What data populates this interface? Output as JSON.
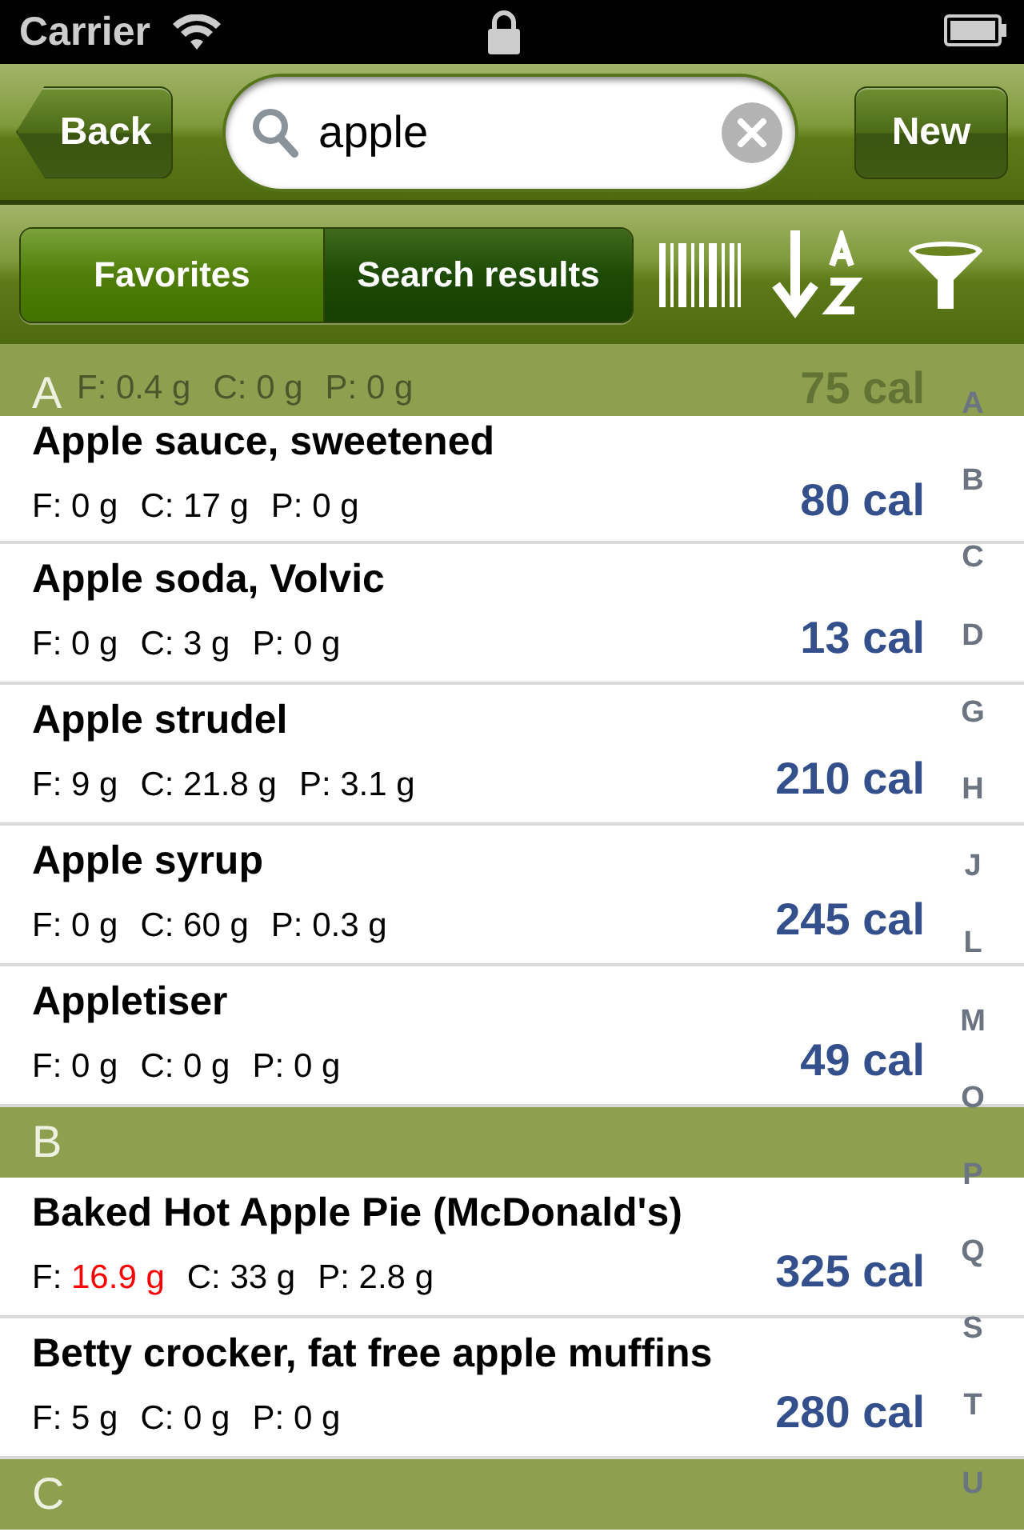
{
  "status_bar": {
    "carrier": "Carrier"
  },
  "nav": {
    "back": "Back",
    "search": {
      "value": "apple"
    },
    "new": "New"
  },
  "segments": [
    {
      "label": "Favorites",
      "selected": false
    },
    {
      "label": "Search results",
      "selected": true
    }
  ],
  "partial_row": {
    "nutrients": [
      {
        "label": "F:",
        "value": "0.4 g",
        "high": false
      },
      {
        "label": "C:",
        "value": "0 g",
        "high": false
      },
      {
        "label": "P:",
        "value": "0 g",
        "high": false
      }
    ],
    "calories": "75 cal"
  },
  "sections": [
    {
      "letter": "A",
      "rows": [
        {
          "name": "Apple sauce, sweetened",
          "nutrients": [
            {
              "label": "F:",
              "value": "0 g",
              "high": false
            },
            {
              "label": "C:",
              "value": "17 g",
              "high": false
            },
            {
              "label": "P:",
              "value": "0 g",
              "high": false
            }
          ],
          "calories": "80 cal"
        },
        {
          "name": "Apple soda, Volvic",
          "nutrients": [
            {
              "label": "F:",
              "value": "0 g",
              "high": false
            },
            {
              "label": "C:",
              "value": "3 g",
              "high": false
            },
            {
              "label": "P:",
              "value": "0 g",
              "high": false
            }
          ],
          "calories": "13 cal"
        },
        {
          "name": "Apple strudel",
          "nutrients": [
            {
              "label": "F:",
              "value": "9 g",
              "high": false
            },
            {
              "label": "C:",
              "value": "21.8 g",
              "high": false
            },
            {
              "label": "P:",
              "value": "3.1 g",
              "high": false
            }
          ],
          "calories": "210 cal"
        },
        {
          "name": "Apple syrup",
          "nutrients": [
            {
              "label": "F:",
              "value": "0 g",
              "high": false
            },
            {
              "label": "C:",
              "value": "60 g",
              "high": false
            },
            {
              "label": "P:",
              "value": "0.3 g",
              "high": false
            }
          ],
          "calories": "245 cal"
        },
        {
          "name": "Appletiser",
          "nutrients": [
            {
              "label": "F:",
              "value": "0 g",
              "high": false
            },
            {
              "label": "C:",
              "value": "0 g",
              "high": false
            },
            {
              "label": "P:",
              "value": "0 g",
              "high": false
            }
          ],
          "calories": "49 cal"
        }
      ]
    },
    {
      "letter": "B",
      "rows": [
        {
          "name": "Baked Hot Apple Pie (McDonald's)",
          "nutrients": [
            {
              "label": "F:",
              "value": "16.9 g",
              "high": true
            },
            {
              "label": "C:",
              "value": "33 g",
              "high": false
            },
            {
              "label": "P:",
              "value": "2.8 g",
              "high": false
            }
          ],
          "calories": "325 cal"
        },
        {
          "name": "Betty crocker, fat free apple muffins",
          "nutrients": [
            {
              "label": "F:",
              "value": "5 g",
              "high": false
            },
            {
              "label": "C:",
              "value": "0 g",
              "high": false
            },
            {
              "label": "P:",
              "value": "0 g",
              "high": false
            }
          ],
          "calories": "280 cal"
        }
      ]
    },
    {
      "letter": "C"
    }
  ],
  "index": [
    "A",
    "B",
    "C",
    "D",
    "G",
    "H",
    "J",
    "L",
    "M",
    "O",
    "P",
    "Q",
    "S",
    "T",
    "U"
  ]
}
